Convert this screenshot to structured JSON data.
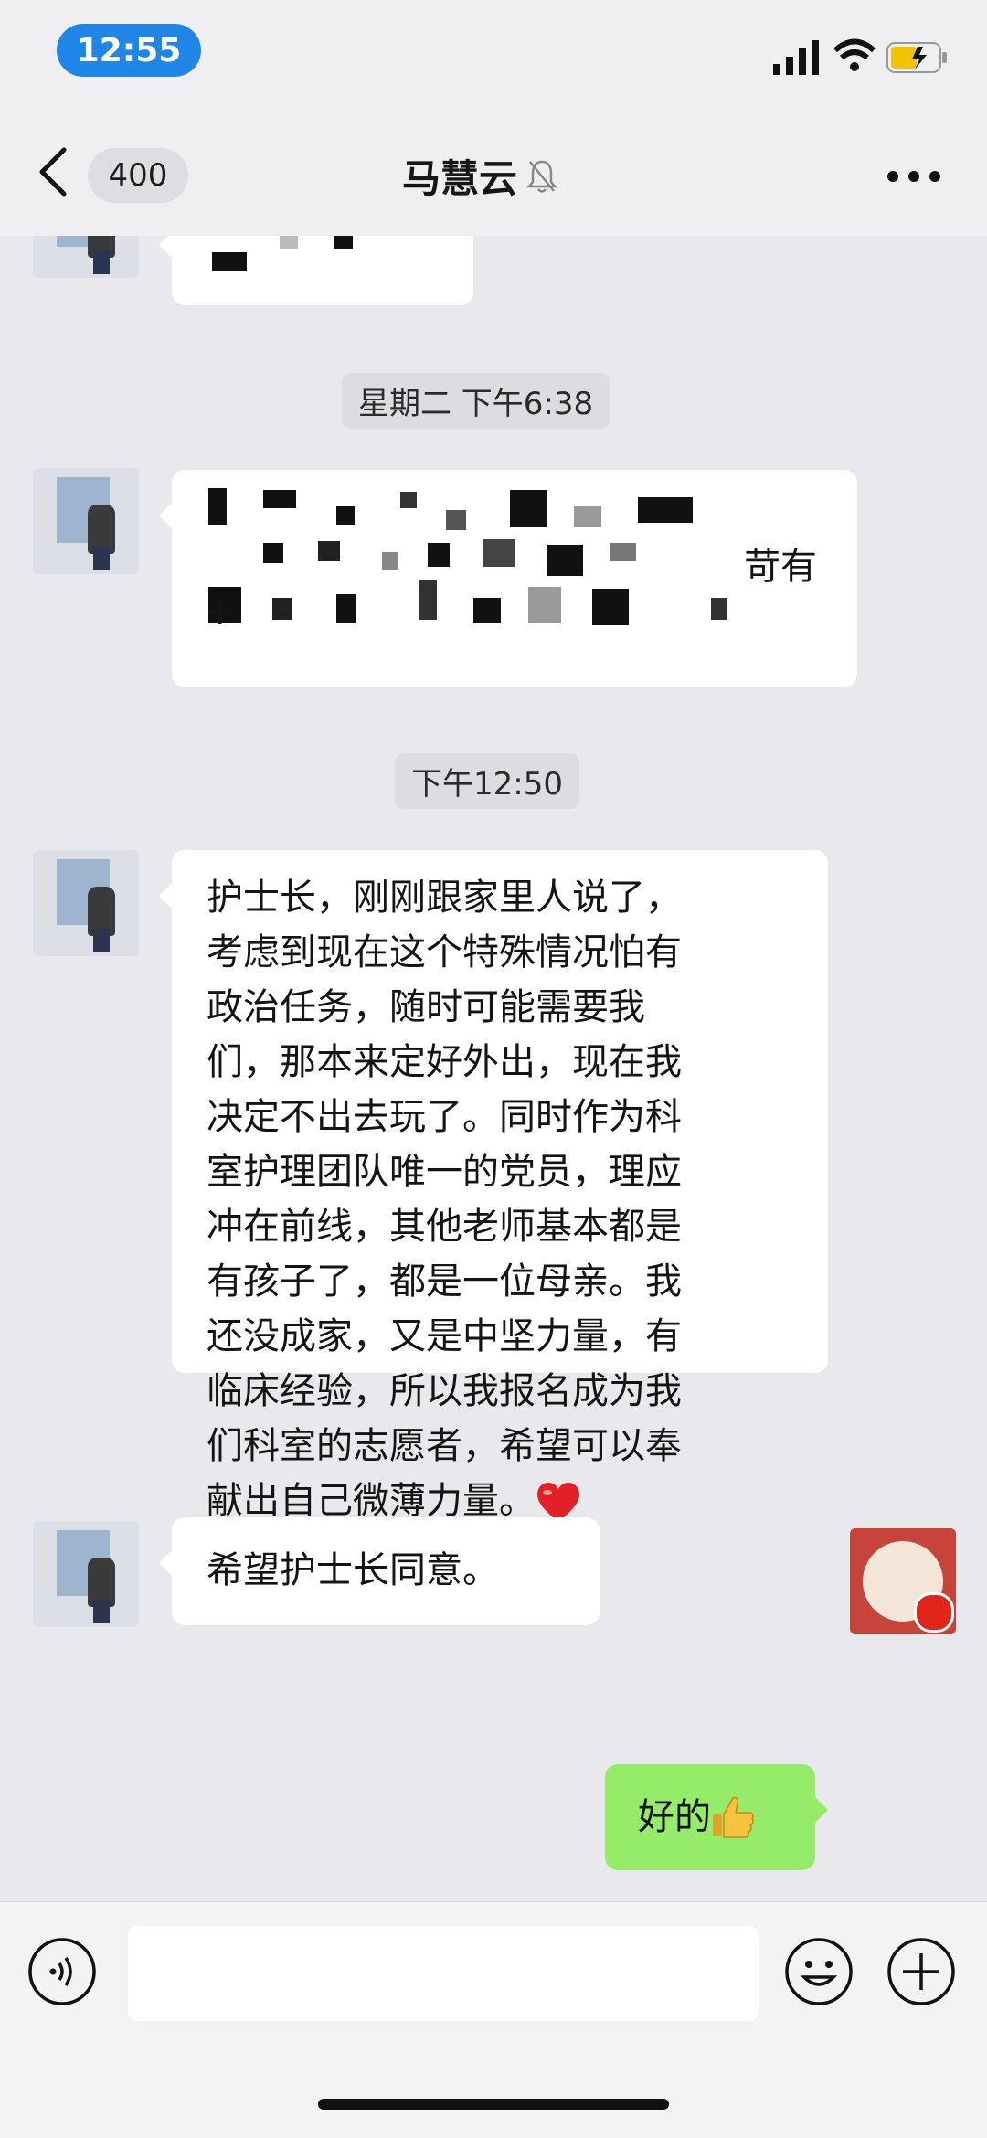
{
  "status_bar": {
    "time": "12:55"
  },
  "nav": {
    "unread_count": "400",
    "title": "马慧云"
  },
  "messages": [
    {
      "type": "incoming",
      "text": "",
      "redacted": true
    },
    {
      "type": "timestamp",
      "text": "星期二 下午6:38"
    },
    {
      "type": "incoming",
      "redacted": true,
      "visible_fragment_1": "苛有",
      "visible_fragment_2": "+"
    },
    {
      "type": "timestamp",
      "text": "下午12:50"
    },
    {
      "type": "incoming",
      "text": "护士长，刚刚跟家里人说了，\n考虑到现在这个特殊情况怕有\n政治任务，随时可能需要我\n们，那本来定好外出，现在我\n决定不出去玩了。同时作为科\n室护理团队唯一的党员，理应\n冲在前线，其他老师基本都是\n有孩子了，都是一位母亲。我\n还没成家，又是中坚力量，有\n临床经验，所以我报名成为我\n们科室的志愿者，希望可以奉\n献出自己微薄力量。",
      "emoji": "red-heart"
    },
    {
      "type": "incoming",
      "text": "希望护士长同意。"
    },
    {
      "type": "outgoing",
      "text": "好的",
      "emoji": "thumbs-up"
    }
  ],
  "colors": {
    "accent": "#1f86e8",
    "outgoing_bubble": "#95ec69",
    "background": "#e9e8ed"
  }
}
